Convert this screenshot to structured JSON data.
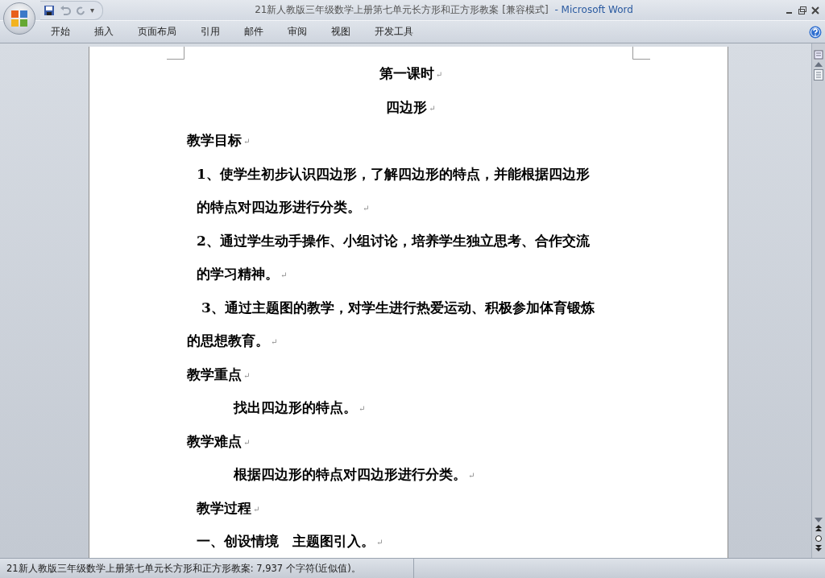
{
  "window": {
    "title": "21新人教版三年级数学上册第七单元长方形和正方形教案 [兼容模式]",
    "app_name": "- Microsoft Word"
  },
  "quick_access": {
    "menu_glyph": "▾"
  },
  "ribbon_tabs": [
    {
      "label": "开始",
      "selected": false
    },
    {
      "label": "插入",
      "selected": false
    },
    {
      "label": "页面布局",
      "selected": false
    },
    {
      "label": "引用",
      "selected": false
    },
    {
      "label": "邮件",
      "selected": false
    },
    {
      "label": "审阅",
      "selected": false
    },
    {
      "label": "视图",
      "selected": false
    },
    {
      "label": "开发工具",
      "selected": false
    }
  ],
  "document": {
    "lines": [
      {
        "kind": "center",
        "text": "第一课时",
        "mark": "↵"
      },
      {
        "kind": "center",
        "text": "四边形",
        "mark": "↵"
      },
      {
        "kind": "left",
        "text": "教学目标",
        "mark": "↵"
      },
      {
        "kind": "indent-small",
        "text": "1、使学生初步认识四边形，了解四边形的特点，并能根据四边形"
      },
      {
        "kind": "indent-small",
        "text": "的特点对四边形进行分类。",
        "mark": "↵"
      },
      {
        "kind": "indent-small",
        "text": "2、通过学生动手操作、小组讨论，培养学生独立思考、合作交流"
      },
      {
        "kind": "indent-small",
        "text": "的学习精神。",
        "mark": "↵"
      },
      {
        "kind": "indent-mid",
        "text": "3、通过主题图的教学，对学生进行热爱运动、积极参加体育锻炼"
      },
      {
        "kind": "left",
        "text": "的思想教育。",
        "mark": "↵"
      },
      {
        "kind": "left",
        "text": "教学重点",
        "mark": "↵"
      },
      {
        "kind": "indent-large",
        "text": "找出四边形的特点。",
        "mark": "↵"
      },
      {
        "kind": "left",
        "text": "教学难点",
        "mark": "↵"
      },
      {
        "kind": "indent-large",
        "text": "根据四边形的特点对四边形进行分类。",
        "mark": "↵"
      },
      {
        "kind": "indent-small",
        "text": "教学过程",
        "mark": "↵"
      },
      {
        "kind": "indent-small",
        "text": "一、创设情境　主题图引入。",
        "mark": "↵"
      }
    ]
  },
  "status_bar": {
    "text": "21新人教版三年级数学上册第七单元长方形和正方形教案: 7,937 个字符(近似值)。"
  }
}
